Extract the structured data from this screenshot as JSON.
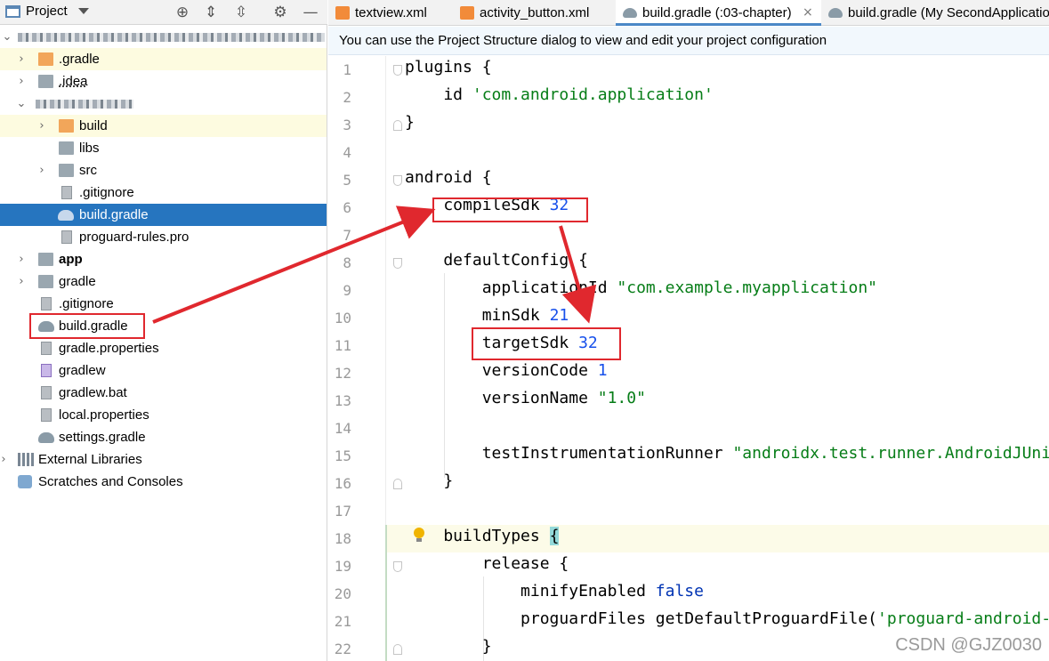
{
  "project_panel": {
    "title": "Project",
    "tree": [
      {
        "label": ".gradle",
        "icon": "folder-orange-icon",
        "expandable": true
      },
      {
        "label": ".idea",
        "icon": "folder-gray-icon",
        "expandable": true
      },
      {
        "label": "build",
        "icon": "folder-orange-icon",
        "expandable": true
      },
      {
        "label": "libs",
        "icon": "folder-gray-icon",
        "expandable": false
      },
      {
        "label": "src",
        "icon": "folder-gray-icon",
        "expandable": true
      },
      {
        "label": ".gitignore",
        "icon": "gitignore-file-icon",
        "expandable": false
      },
      {
        "label": "build.gradle",
        "icon": "gradle-file-icon",
        "expandable": false,
        "selected": true
      },
      {
        "label": "proguard-rules.pro",
        "icon": "text-file-icon",
        "expandable": false
      },
      {
        "label": "app",
        "icon": "module-folder-icon",
        "expandable": true,
        "bold": true
      },
      {
        "label": "gradle",
        "icon": "folder-gray-icon",
        "expandable": true
      },
      {
        "label": ".gitignore",
        "icon": "gitignore-file-icon",
        "expandable": false
      },
      {
        "label": "build.gradle",
        "icon": "gradle-file-icon",
        "expandable": false
      },
      {
        "label": "gradle.properties",
        "icon": "properties-file-icon",
        "expandable": false
      },
      {
        "label": "gradlew",
        "icon": "shell-script-icon",
        "expandable": false
      },
      {
        "label": "gradlew.bat",
        "icon": "text-file-icon",
        "expandable": false
      },
      {
        "label": "local.properties",
        "icon": "properties-file-icon",
        "expandable": false
      },
      {
        "label": "settings.gradle",
        "icon": "gradle-file-icon",
        "expandable": false
      },
      {
        "label": "External Libraries",
        "icon": "libraries-icon",
        "expandable": true
      },
      {
        "label": "Scratches and Consoles",
        "icon": "scratches-icon",
        "expandable": false
      }
    ]
  },
  "tabs": [
    {
      "label": "textview.xml",
      "icon": "xml-file-icon",
      "active": false
    },
    {
      "label": "activity_button.xml",
      "icon": "xml-file-icon",
      "active": false
    },
    {
      "label": "build.gradle (:03-chapter)",
      "icon": "gradle-file-icon",
      "active": true
    },
    {
      "label": "build.gradle (My SecondApplicatio",
      "icon": "gradle-file-icon",
      "active": false
    }
  ],
  "banner": {
    "text": "You can use the Project Structure dialog to view and edit your project configuration"
  },
  "editor": {
    "line_numbers": [
      "1",
      "2",
      "3",
      "4",
      "5",
      "6",
      "7",
      "8",
      "9",
      "10",
      "11",
      "12",
      "13",
      "14",
      "15",
      "16",
      "17",
      "18",
      "19",
      "20",
      "21",
      "22"
    ],
    "lines": [
      [
        {
          "t": "plugins {"
        }
      ],
      [
        {
          "t": "    id "
        },
        {
          "t": "'com.android.application'",
          "c": "str"
        }
      ],
      [
        {
          "t": "}"
        }
      ],
      [
        {
          "t": ""
        }
      ],
      [
        {
          "t": "android {"
        }
      ],
      [
        {
          "t": "    compileSdk "
        },
        {
          "t": "32",
          "c": "num"
        }
      ],
      [
        {
          "t": ""
        }
      ],
      [
        {
          "t": "    defaultConfig {"
        }
      ],
      [
        {
          "t": "        applicationId "
        },
        {
          "t": "\"com.example.myapplication\"",
          "c": "str"
        }
      ],
      [
        {
          "t": "        minSdk "
        },
        {
          "t": "21",
          "c": "num"
        }
      ],
      [
        {
          "t": "        targetSdk "
        },
        {
          "t": "32",
          "c": "num"
        }
      ],
      [
        {
          "t": "        versionCode "
        },
        {
          "t": "1",
          "c": "num"
        }
      ],
      [
        {
          "t": "        versionName "
        },
        {
          "t": "\"1.0\"",
          "c": "str"
        }
      ],
      [
        {
          "t": ""
        }
      ],
      [
        {
          "t": "        testInstrumentationRunner "
        },
        {
          "t": "\"androidx.test.runner.AndroidJUnitRunner\"",
          "c": "str"
        }
      ],
      [
        {
          "t": "    }"
        }
      ],
      [
        {
          "t": ""
        }
      ],
      [
        {
          "t": "    buildTypes "
        },
        {
          "t": "{",
          "c": "brace"
        }
      ],
      [
        {
          "t": "        release {"
        }
      ],
      [
        {
          "t": "            minifyEnabled "
        },
        {
          "t": "false",
          "c": "kw"
        }
      ],
      [
        {
          "t": "            proguardFiles getDefaultProguardFile("
        },
        {
          "t": "'proguard-android-optimize.txt'",
          "c": "str"
        }
      ],
      [
        {
          "t": "        }"
        }
      ]
    ]
  },
  "watermark": "CSDN @GJZ0030",
  "colors": {
    "selection": "#2675bf",
    "annotation_red": "#e0282e",
    "string_green": "#067d17",
    "number_blue": "#1750eb",
    "keyword_blue": "#0033b3"
  }
}
